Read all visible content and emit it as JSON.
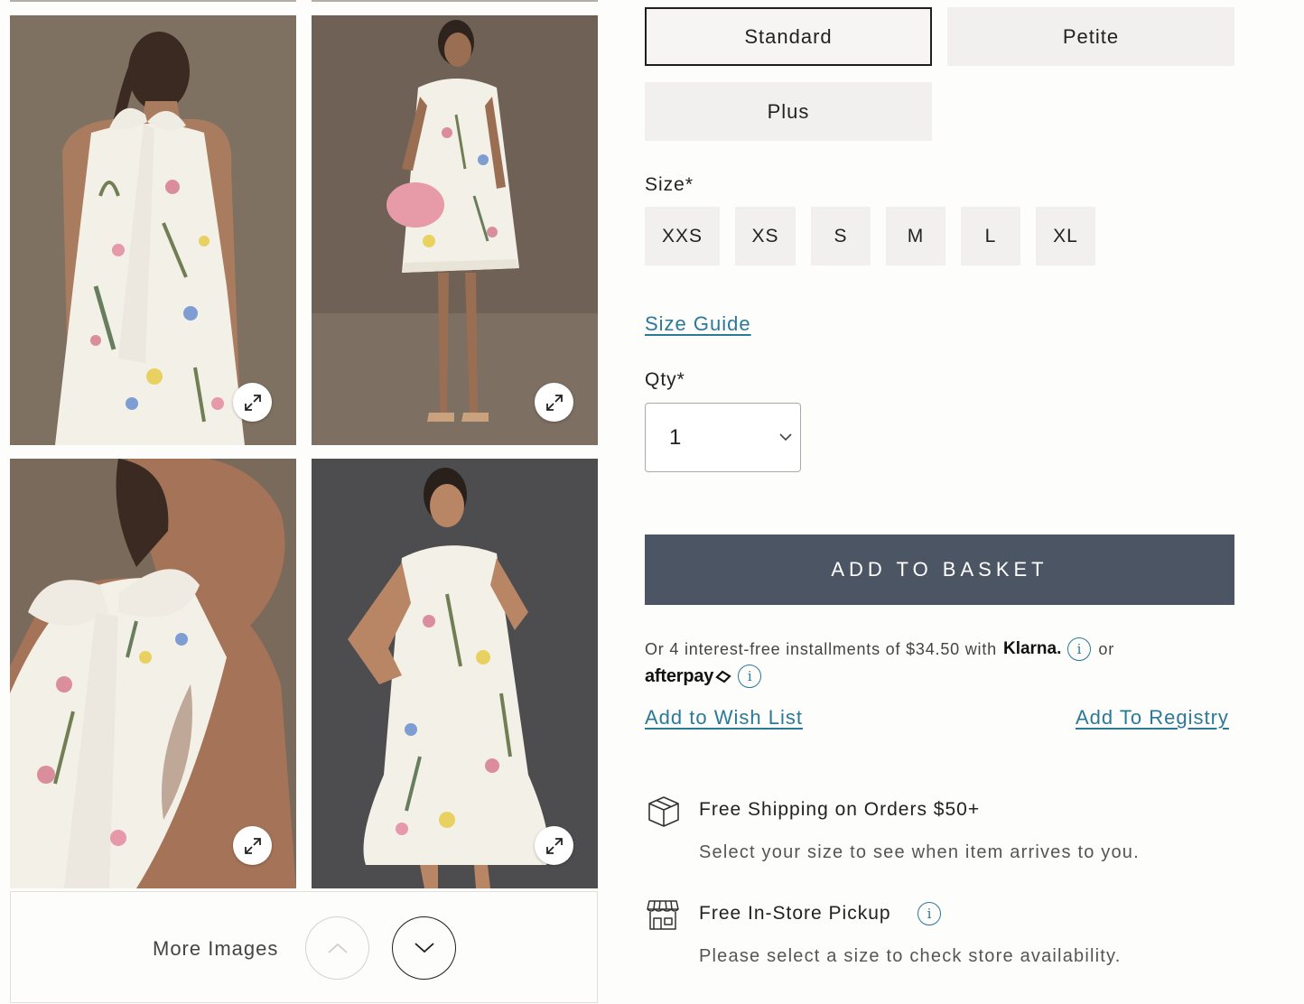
{
  "gallery": {
    "images": [
      {
        "name": "back-view-standing",
        "expand_icon": "expand-arrows-icon"
      },
      {
        "name": "front-view-full-length",
        "expand_icon": "expand-arrows-icon"
      },
      {
        "name": "back-tie-detail",
        "expand_icon": "expand-arrows-icon"
      },
      {
        "name": "front-view-hand-on-hip",
        "expand_icon": "expand-arrows-icon"
      }
    ],
    "more_images_label": "More Images",
    "up_icon": "chevron-up-icon",
    "down_icon": "chevron-down-icon"
  },
  "fit": {
    "options": [
      "Standard",
      "Petite",
      "Plus"
    ],
    "selected": "Standard"
  },
  "size": {
    "label": "Size*",
    "options": [
      "XXS",
      "XS",
      "S",
      "M",
      "L",
      "XL"
    ]
  },
  "size_guide_label": "Size Guide",
  "qty": {
    "label": "Qty*",
    "value": "1"
  },
  "add_to_basket_label": "ADD TO BASKET",
  "installments": {
    "text": "Or 4 interest-free installments of $34.50 with",
    "klarna": "Klarna.",
    "or": "or",
    "afterpay": "afterpay"
  },
  "wish_list_label": "Add to Wish List",
  "registry_label": "Add To Registry",
  "perks": {
    "shipping_title": "Free Shipping on Orders $50+",
    "shipping_text": "Select your size to see when item arrives to you.",
    "pickup_title": "Free In-Store Pickup",
    "pickup_text": "Please select a size to check store availability."
  },
  "colors": {
    "accent_link": "#2c7898",
    "basket_button": "#4b5563",
    "photo_bg_warm": "#7a6c5c",
    "photo_bg_grey": "#4d4d4f"
  }
}
